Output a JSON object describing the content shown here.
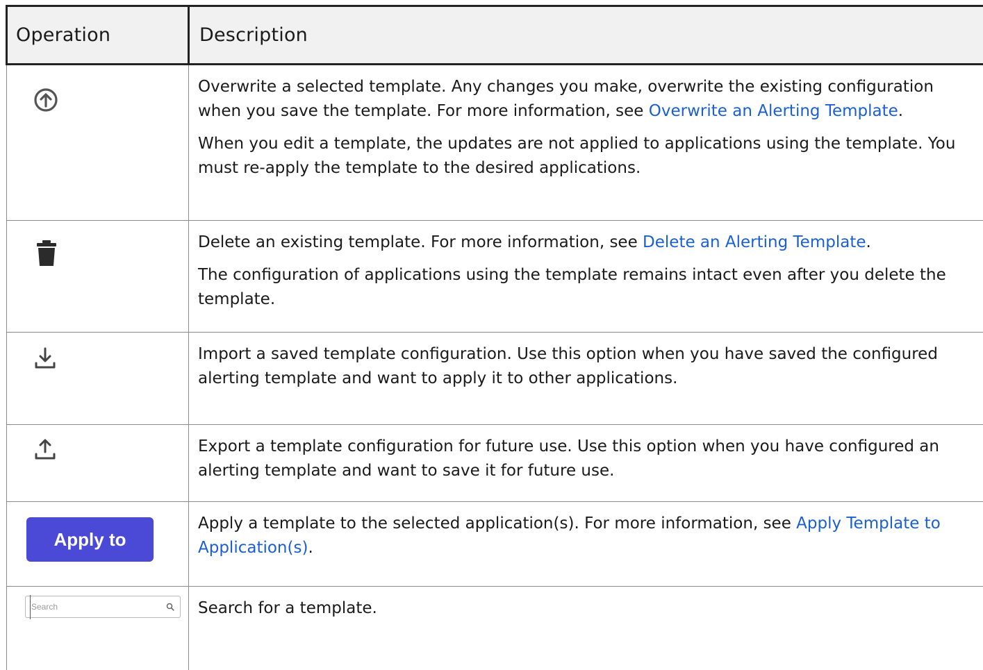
{
  "table": {
    "headers": {
      "operation": "Operation",
      "description": "Description"
    },
    "rows": [
      {
        "icon": "overwrite-upload-circle-icon",
        "p1_text": "Overwrite a selected template. Any changes you make, overwrite the existing configuration when you save the template. For more information, see ",
        "p1_link": "Overwrite an Alerting Template",
        "p1_end": ".",
        "p2_text": "When you edit a template, the updates are not applied to applications using the template. You must re-apply the template to the desired applications."
      },
      {
        "icon": "trash-icon",
        "p1_text": "Delete an existing template. For more information, see ",
        "p1_link": "Delete an Alerting Template",
        "p1_end": ".",
        "p2_text": "The configuration of applications using the template remains intact even after you delete the template."
      },
      {
        "icon": "import-download-icon",
        "p1_text": "Import a saved template configuration. Use this option when you have saved the configured alerting template and want to apply it to other applications."
      },
      {
        "icon": "export-upload-icon",
        "p1_text": "Export a template configuration for future use. Use this option when you have configured an alerting template and want to save it for future use."
      },
      {
        "button_label": "Apply to",
        "p1_text": "Apply a template to the selected application(s). For more information, see ",
        "p1_link": "Apply Template to Application(s)",
        "p1_end": "."
      },
      {
        "search_placeholder": "Search",
        "icon": "search-icon",
        "p1_text": "Search for a template."
      }
    ]
  },
  "colors": {
    "link": "#1a5fd6",
    "button": "#4b4ad6",
    "header_bg": "#f1f1f1"
  }
}
